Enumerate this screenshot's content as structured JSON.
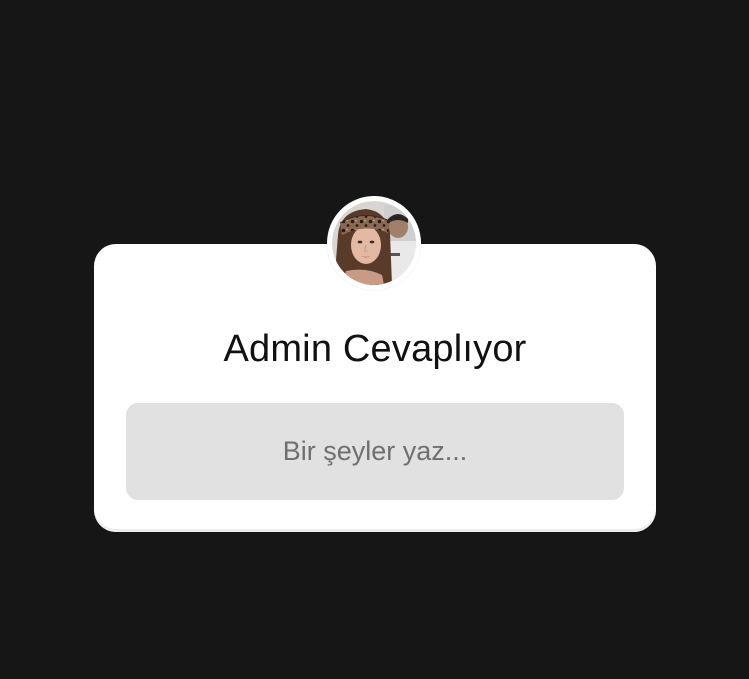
{
  "question_sticker": {
    "title": "Admin Cevaplıyor",
    "reply_placeholder": "Bir şeyler yaz...",
    "avatar_icon": "profile-photo-avatar"
  },
  "colors": {
    "background": "#161616",
    "card": "#ffffff",
    "input_background": "#e1e1e1",
    "placeholder_text": "#6f6f6f",
    "title_text": "#111111"
  }
}
